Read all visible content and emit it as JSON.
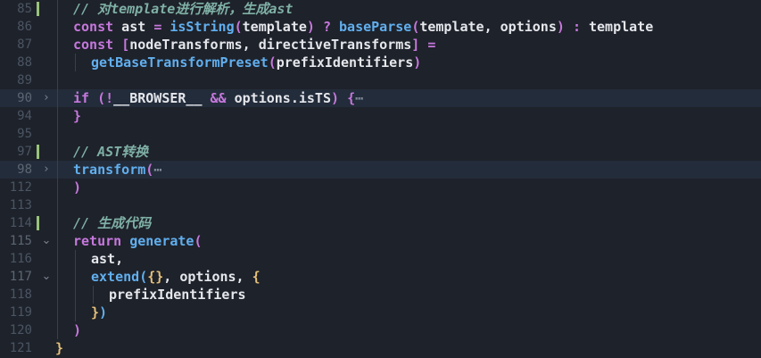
{
  "editor": {
    "lines": [
      {
        "num": "85",
        "indent": 1,
        "git": true,
        "fold": "",
        "hl": false,
        "tokens": [
          {
            "t": "// 对template进行解析，生成ast",
            "c": "cm"
          }
        ]
      },
      {
        "num": "86",
        "indent": 1,
        "git": false,
        "fold": "",
        "hl": false,
        "tokens": [
          {
            "t": "const",
            "c": "kw"
          },
          {
            "t": " ast ",
            "c": "id"
          },
          {
            "t": "=",
            "c": "op"
          },
          {
            "t": " ",
            "c": "id"
          },
          {
            "t": "isString",
            "c": "fn"
          },
          {
            "t": "(",
            "c": "b2"
          },
          {
            "t": "template",
            "c": "id"
          },
          {
            "t": ")",
            "c": "b2"
          },
          {
            "t": " ",
            "c": "id"
          },
          {
            "t": "?",
            "c": "op"
          },
          {
            "t": " ",
            "c": "id"
          },
          {
            "t": "baseParse",
            "c": "fn"
          },
          {
            "t": "(",
            "c": "b2"
          },
          {
            "t": "template, options",
            "c": "id"
          },
          {
            "t": ")",
            "c": "b2"
          },
          {
            "t": " ",
            "c": "id"
          },
          {
            "t": ":",
            "c": "op"
          },
          {
            "t": " template",
            "c": "id"
          }
        ]
      },
      {
        "num": "87",
        "indent": 1,
        "git": false,
        "fold": "",
        "hl": false,
        "tokens": [
          {
            "t": "const",
            "c": "kw"
          },
          {
            "t": " ",
            "c": "id"
          },
          {
            "t": "[",
            "c": "b2"
          },
          {
            "t": "nodeTransforms, directiveTransforms",
            "c": "id"
          },
          {
            "t": "]",
            "c": "b2"
          },
          {
            "t": " ",
            "c": "id"
          },
          {
            "t": "=",
            "c": "op"
          }
        ]
      },
      {
        "num": "88",
        "indent": 2,
        "git": false,
        "fold": "",
        "hl": false,
        "tokens": [
          {
            "t": "getBaseTransformPreset",
            "c": "fn"
          },
          {
            "t": "(",
            "c": "b2"
          },
          {
            "t": "prefixIdentifiers",
            "c": "id"
          },
          {
            "t": ")",
            "c": "b2"
          }
        ]
      },
      {
        "num": "89",
        "indent": 0,
        "git": false,
        "fold": "",
        "hl": false,
        "tokens": []
      },
      {
        "num": "90",
        "indent": 1,
        "git": false,
        "fold": "›",
        "hl": true,
        "tokens": [
          {
            "t": "if",
            "c": "kw"
          },
          {
            "t": " ",
            "c": "id"
          },
          {
            "t": "(",
            "c": "b2"
          },
          {
            "t": "!",
            "c": "op"
          },
          {
            "t": "__BROWSER__",
            "c": "id"
          },
          {
            "t": " ",
            "c": "id"
          },
          {
            "t": "&&",
            "c": "op"
          },
          {
            "t": " options.isTS",
            "c": "id"
          },
          {
            "t": ")",
            "c": "b2"
          },
          {
            "t": " ",
            "c": "id"
          },
          {
            "t": "{",
            "c": "b2"
          },
          {
            "t": "⋯",
            "c": "el"
          }
        ]
      },
      {
        "num": "94",
        "indent": 1,
        "git": false,
        "fold": "",
        "hl": false,
        "tokens": [
          {
            "t": "}",
            "c": "b2"
          }
        ]
      },
      {
        "num": "95",
        "indent": 0,
        "git": false,
        "fold": "",
        "hl": false,
        "tokens": []
      },
      {
        "num": "97",
        "indent": 1,
        "git": true,
        "fold": "",
        "hl": false,
        "tokens": [
          {
            "t": "// AST转换",
            "c": "cm"
          }
        ]
      },
      {
        "num": "98",
        "indent": 1,
        "git": false,
        "fold": "›",
        "hl": true,
        "tokens": [
          {
            "t": "transform",
            "c": "fn"
          },
          {
            "t": "(",
            "c": "b2"
          },
          {
            "t": "⋯",
            "c": "el"
          }
        ]
      },
      {
        "num": "112",
        "indent": 1,
        "git": false,
        "fold": "",
        "hl": false,
        "tokens": [
          {
            "t": ")",
            "c": "b2"
          }
        ]
      },
      {
        "num": "113",
        "indent": 0,
        "git": false,
        "fold": "",
        "hl": false,
        "tokens": []
      },
      {
        "num": "114",
        "indent": 1,
        "git": true,
        "fold": "",
        "hl": false,
        "tokens": [
          {
            "t": "// 生成代码",
            "c": "cm"
          }
        ]
      },
      {
        "num": "115",
        "indent": 1,
        "git": false,
        "fold": "⌄",
        "hl": false,
        "tokens": [
          {
            "t": "return",
            "c": "kw"
          },
          {
            "t": " ",
            "c": "id"
          },
          {
            "t": "generate",
            "c": "fn"
          },
          {
            "t": "(",
            "c": "b2"
          }
        ]
      },
      {
        "num": "116",
        "indent": 2,
        "git": false,
        "fold": "",
        "hl": false,
        "tokens": [
          {
            "t": "ast,",
            "c": "id"
          }
        ]
      },
      {
        "num": "117",
        "indent": 2,
        "git": false,
        "fold": "⌄",
        "hl": false,
        "tokens": [
          {
            "t": "extend",
            "c": "fn"
          },
          {
            "t": "(",
            "c": "b3"
          },
          {
            "t": "{}",
            "c": "b1"
          },
          {
            "t": ", options, ",
            "c": "id"
          },
          {
            "t": "{",
            "c": "b1"
          }
        ]
      },
      {
        "num": "118",
        "indent": 3,
        "git": false,
        "fold": "",
        "hl": false,
        "tokens": [
          {
            "t": "prefixIdentifiers",
            "c": "id"
          }
        ]
      },
      {
        "num": "119",
        "indent": 2,
        "git": false,
        "fold": "",
        "hl": false,
        "tokens": [
          {
            "t": "}",
            "c": "b1"
          },
          {
            "t": ")",
            "c": "b3"
          }
        ]
      },
      {
        "num": "120",
        "indent": 1,
        "git": false,
        "fold": "",
        "hl": false,
        "tokens": [
          {
            "t": ")",
            "c": "b2"
          }
        ]
      },
      {
        "num": "121",
        "indent": 0,
        "git": false,
        "fold": "",
        "hl": false,
        "tokens": [
          {
            "t": "}",
            "c": "b1"
          }
        ]
      }
    ]
  }
}
